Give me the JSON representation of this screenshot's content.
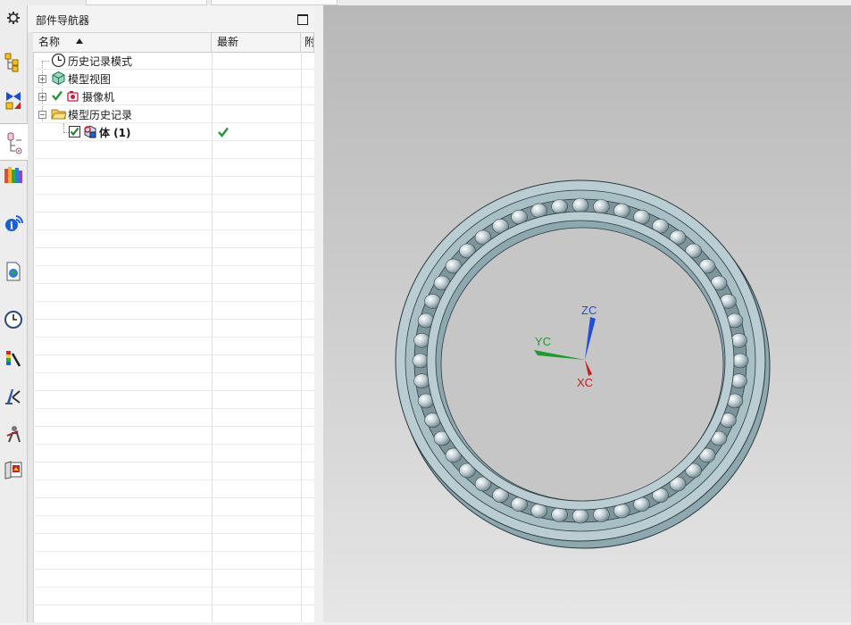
{
  "navigator": {
    "title": "部件导航器",
    "columns": {
      "name": "名称",
      "latest": "最新",
      "third": "附"
    },
    "rows": [
      {
        "label": "历史记录模式",
        "icon": "clock-icon"
      },
      {
        "label": "模型视图",
        "icon": "model-view-icon"
      },
      {
        "label": "摄像机",
        "icon": "camera-icon"
      },
      {
        "label": "模型历史记录",
        "icon": "folder-icon"
      },
      {
        "label": "体 (1)",
        "icon": "body-icon",
        "latest": "✔"
      }
    ]
  },
  "resource_bar": {
    "icons": [
      "settings-icon",
      "assembly-navigator-icon",
      "constraint-navigator-icon",
      "part-navigator-icon",
      "reuse-library-icon",
      "hd3d-tools-icon",
      "web-browser-icon",
      "history-icon",
      "system-materials-icon",
      "process-studio-icon",
      "roles-icon",
      "system-scenes-icon"
    ]
  },
  "triad": {
    "x": "XC",
    "y": "YC",
    "z": "ZC"
  },
  "colors": {
    "accent_green": "#1f9a2e",
    "x_axis": "#c02020",
    "y_axis": "#1f9a2e",
    "z_axis": "#1f4fd8",
    "bearing": "#b9cdd3"
  }
}
